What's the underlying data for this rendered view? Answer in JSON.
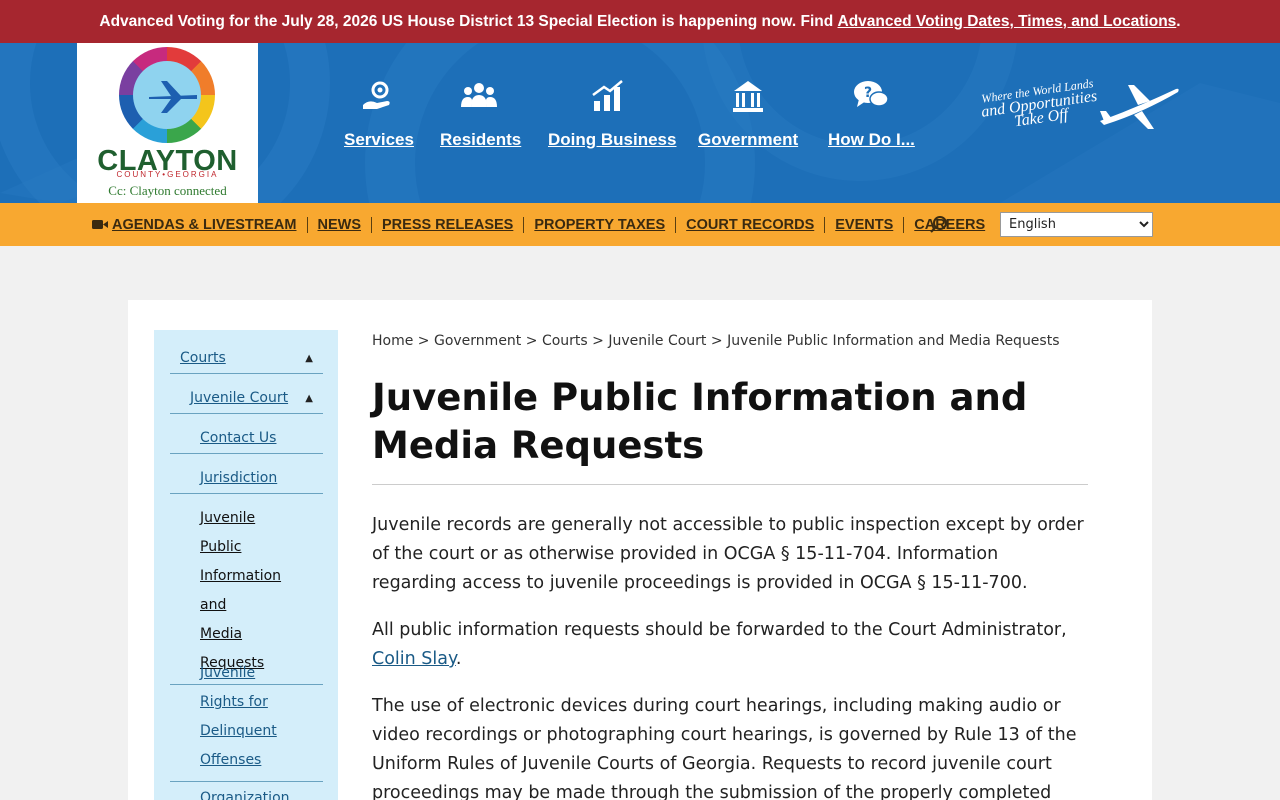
{
  "alert": {
    "text": "Advanced Voting for the July 28, 2026 US House District 13 Special Election is happening now. Find ",
    "link": "Advanced Voting Dates, Times, and Locations",
    "suffix": "."
  },
  "logo": {
    "word": "CLAYTON",
    "sub": "COUNTY•GEORGIA",
    "tagline": "Cc: Clayton connected"
  },
  "main_nav": [
    {
      "label": "Services",
      "icon": "gear-hand-icon"
    },
    {
      "label": "Residents",
      "icon": "people-icon"
    },
    {
      "label": "Doing Business",
      "icon": "growth-chart-icon"
    },
    {
      "label": "Government",
      "icon": "capitol-building-icon"
    },
    {
      "label": "How Do I...",
      "icon": "question-chat-icon"
    }
  ],
  "tagline": {
    "line1": "Where the World Lands",
    "line2": "and Opportunities",
    "line3": "Take Off"
  },
  "secondary_nav": [
    {
      "label": "Agendas & Livestream",
      "icon": "video-camera-icon"
    },
    {
      "label": "News"
    },
    {
      "label": "Press Releases"
    },
    {
      "label": "Property Taxes"
    },
    {
      "label": "Court Records"
    },
    {
      "label": "Events"
    },
    {
      "label": "Careers"
    }
  ],
  "language": {
    "selected": "English"
  },
  "sidebar": {
    "items": [
      {
        "label": "Courts",
        "expanded": true
      },
      {
        "label": "Juvenile Court",
        "expanded": true
      },
      {
        "label": "Contact Us"
      },
      {
        "label": "Jurisdiction"
      },
      {
        "label": "Juvenile Public Information and Media Requests",
        "active": true
      },
      {
        "label": "Juvenile Rights for Delinquent Offenses"
      },
      {
        "label": "Organization"
      }
    ]
  },
  "breadcrumb": [
    "Home",
    "Government",
    "Courts",
    "Juvenile Court",
    "Juvenile Public Information and Media Requests"
  ],
  "breadcrumb_sep": ">",
  "page": {
    "title": "Juvenile Public Information and Media Requests",
    "p1": "Juvenile records are generally not accessible to public inspection except by order of the court or as otherwise provided in OCGA § 15-11-704.  Information regarding access to juvenile proceedings is provided in OCGA § 15-11-700.",
    "p2_text": "All public information requests should be forwarded to the Court Administrator, ",
    "p2_link": "Colin Slay",
    "p2_suffix": ".",
    "p3": "The use of electronic devices during court hearings, including making audio or video recordings or photographing court hearings, is governed by Rule 13 of the Uniform Rules of Juvenile Courts of Georgia. Requests to record juvenile court proceedings may be made through the submission of the properly completed form listed as"
  },
  "colors": {
    "alert_bg": "#a6262f",
    "header_bg": "#1d6fb8",
    "secondary_bar_bg": "#f8a830",
    "sidebar_bg": "#d4eefa",
    "link": "#1a5a86"
  }
}
